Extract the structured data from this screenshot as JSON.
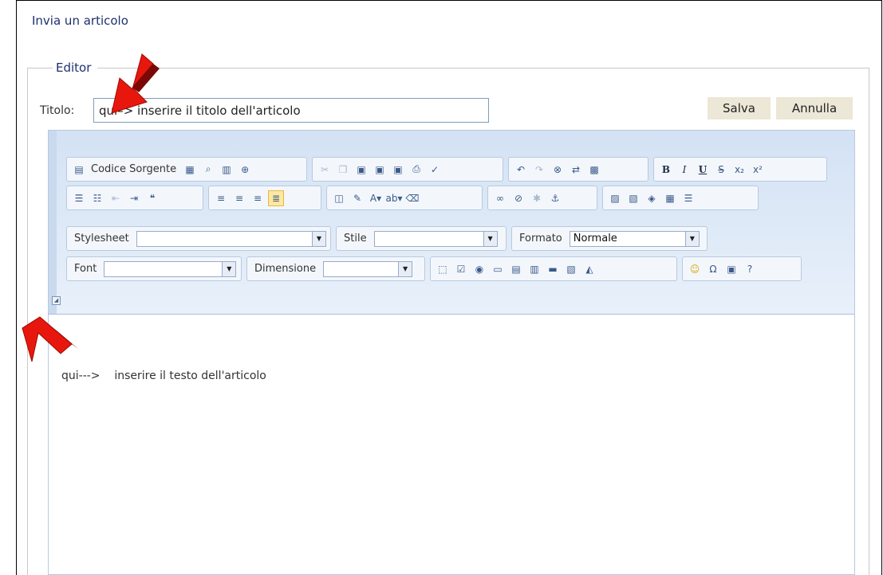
{
  "page": {
    "title": "Invia un articolo",
    "fieldset_legend": "Editor"
  },
  "form": {
    "title_label": "Titolo:",
    "title_value": "qui–> inserire il titolo dell'articolo",
    "save_label": "Salva",
    "cancel_label": "Annulla"
  },
  "toolbar": {
    "source_label": "Codice Sorgente",
    "stylesheet_label": "Stylesheet",
    "stylesheet_value": "",
    "style_label": "Stile",
    "style_value": "",
    "format_label": "Formato",
    "format_value": "Normale",
    "font_label": "Font",
    "font_value": "",
    "size_label": "Dimensione",
    "size_value": ""
  },
  "editor": {
    "body_text": "qui--->    inserire il testo dell'articolo"
  },
  "colors": {
    "accent_arrow": "#e8170d",
    "toolbar_bg": "#d3e2f4",
    "heading": "#1f2f6e"
  }
}
